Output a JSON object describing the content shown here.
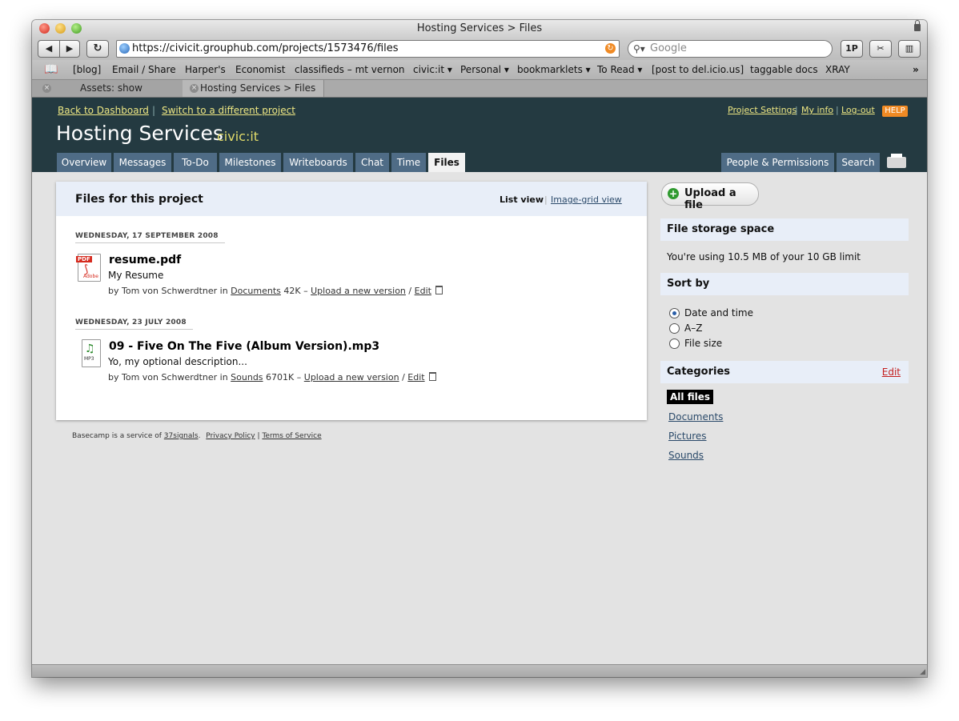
{
  "browser": {
    "window_title": "Hosting Services > Files",
    "url": "https://civicit.grouphub.com/projects/1573476/files",
    "search_placeholder": "Google",
    "onepassword_label": "1P",
    "bookmarks": [
      "[blog]",
      "Email / Share",
      "Harper's",
      "Economist",
      "classifieds – mt vernon",
      "civic:it ▾",
      "Personal ▾",
      "bookmarklets ▾",
      "To Read ▾",
      "[post to del.icio.us]",
      "taggable docs",
      "XRAY"
    ],
    "tabs": [
      "Assets: show",
      "Hosting Services > Files"
    ]
  },
  "header": {
    "back_link": "Back to Dashboard",
    "separator": "|",
    "switch_link": "Switch to a different project",
    "project_name": "Hosting Services",
    "company_name": "civic:it",
    "project_settings": "Project Settings",
    "my_info": "My info",
    "logout": "Log-out",
    "help": "HELP",
    "nav_tabs": [
      "Overview",
      "Messages",
      "To-Do",
      "Milestones",
      "Writeboards",
      "Chat",
      "Time",
      "Files"
    ],
    "people_permissions": "People & Permissions",
    "search": "Search"
  },
  "files_panel": {
    "title": "Files for this project",
    "list_view": "List view",
    "image_grid_view": "Image-grid view",
    "groups": [
      {
        "date": "WEDNESDAY, 17 SEPTEMBER 2008",
        "file": {
          "name": "resume.pdf",
          "description": "My Resume",
          "by": "by Tom von Schwerdtner in",
          "category": "Documents",
          "size": "42K –",
          "upload": "Upload a new version",
          "slash": "/",
          "edit": "Edit",
          "icon_label": "PDF",
          "icon_sub": "Adobe"
        }
      },
      {
        "date": "WEDNESDAY, 23 JULY 2008",
        "file": {
          "name": "09 - Five On The Five (Album Version).mp3",
          "description": "Yo, my optional description...",
          "by": "by Tom von Schwerdtner in",
          "category": "Sounds",
          "size": "6701K –",
          "upload": "Upload a new version",
          "slash": "/",
          "edit": "Edit",
          "icon_label": "MP3"
        }
      }
    ]
  },
  "footer": {
    "prefix": "Basecamp is a service of",
    "company": "37signals",
    "privacy": "Privacy Policy",
    "sep": "|",
    "terms": "Terms of Service"
  },
  "sidebar": {
    "upload_button": "Upload a file",
    "storage_title": "File storage space",
    "storage_text": "You're using 10.5 MB of your 10 GB limit",
    "sort_title": "Sort by",
    "sort_options": [
      "Date and time",
      "A–Z",
      "File size"
    ],
    "sort_selected": "Date and time",
    "categories_title": "Categories",
    "categories_edit": "Edit",
    "all_files": "All files",
    "categories": [
      "Documents",
      "Pictures",
      "Sounds"
    ]
  },
  "colors": {
    "header_bg": "#243a41",
    "nav_tab_bg": "#4f6c86",
    "link_yellow": "#eee783",
    "panel_head_bg": "#e8eef8",
    "help_orange": "#f08a24"
  }
}
